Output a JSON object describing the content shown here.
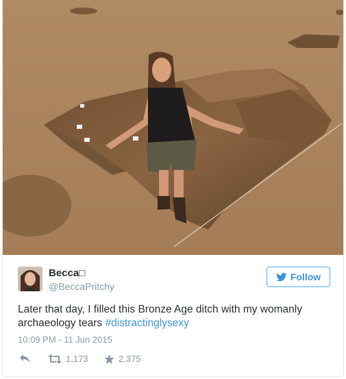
{
  "tweet": {
    "user": {
      "display_name": "Becca□",
      "handle": "@BeccaPritchy",
      "avatar": "profile-photo"
    },
    "follow_label": "Follow",
    "follow_icon": "twitter-bird-icon",
    "text": "Later that day, I filled this Bronze Age ditch with my womanly archaeology tears ",
    "hashtag": "#distractinglysexy",
    "timestamp": "10:09 PM - 11 Jun 2015",
    "actions": {
      "reply_icon": "reply-icon",
      "retweet_icon": "retweet-icon",
      "retweets": "1,173",
      "favorite_icon": "star-icon",
      "favorites": "2,375"
    },
    "colors": {
      "link": "#3b94d9",
      "follow_border": "#55acee",
      "text": "#292f33",
      "muted": "#8899a6"
    }
  }
}
